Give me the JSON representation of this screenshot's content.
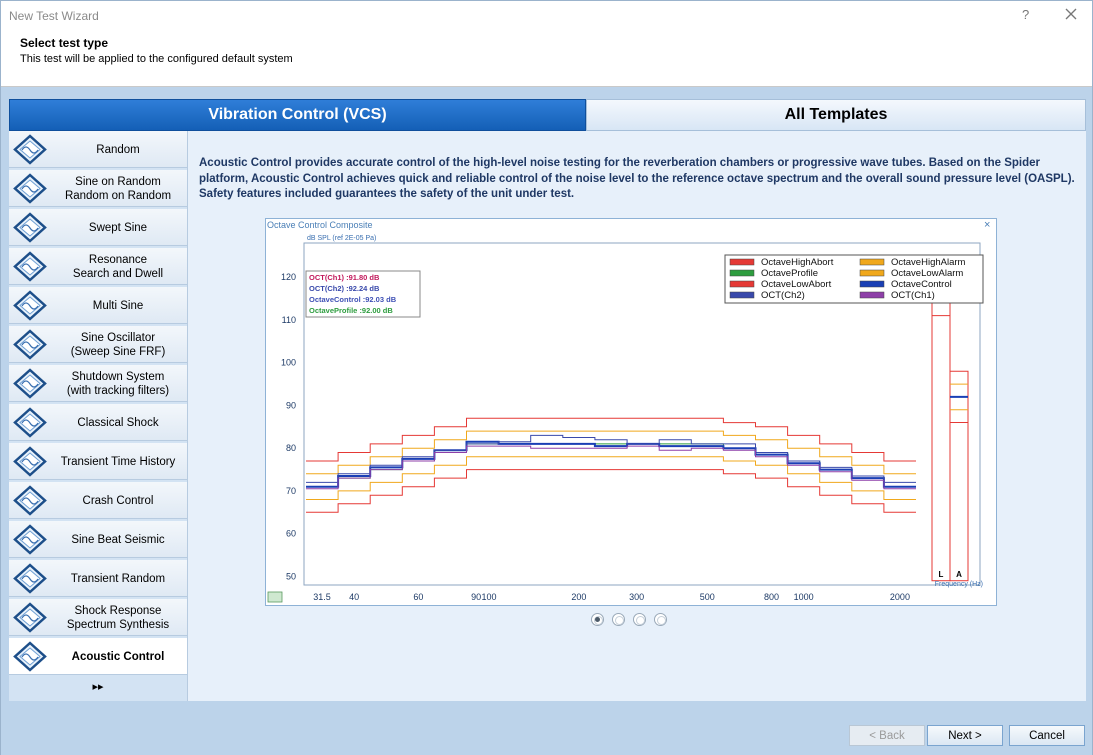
{
  "window": {
    "title": "New Test Wizard",
    "help_glyph": "?"
  },
  "header": {
    "title": "Select test type",
    "subtitle": "This test will be applied to the configured default system"
  },
  "tabs": [
    {
      "label": "Vibration Control (VCS)",
      "active": true
    },
    {
      "label": "All Templates",
      "active": false
    }
  ],
  "sidebar": {
    "items": [
      {
        "label": "Random"
      },
      {
        "label": "Sine on Random\nRandom on Random"
      },
      {
        "label": "Swept Sine"
      },
      {
        "label": "Resonance\nSearch and Dwell"
      },
      {
        "label": "Multi Sine"
      },
      {
        "label": "Sine Oscillator\n(Sweep Sine FRF)"
      },
      {
        "label": "Shutdown System\n(with tracking filters)"
      },
      {
        "label": "Classical Shock"
      },
      {
        "label": "Transient Time History"
      },
      {
        "label": "Crash Control"
      },
      {
        "label": "Sine Beat Seismic"
      },
      {
        "label": "Transient Random"
      },
      {
        "label": "Shock Response\nSpectrum Synthesis"
      },
      {
        "label": "Acoustic Control",
        "active": true
      }
    ],
    "more_glyph": "▸▸"
  },
  "description": "Acoustic Control provides accurate control of the high-level noise testing for the reverberation chambers or progressive wave tubes. Based on the Spider platform, Acoustic Control achieves quick and reliable control of the noise level to the reference octave spectrum and the overall sound pressure level (OASPL). Safety features included guarantees the safety of the unit under test.",
  "chart_panel": {
    "title": "Octave Control Composite",
    "close_glyph": "×"
  },
  "chart_data": {
    "type": "line",
    "ylabel": "dB SPL (ref 2E-05 Pa)",
    "xlabel": "Frequency (Hz)",
    "y_ticks": [
      50,
      60,
      70,
      80,
      90,
      100,
      110,
      120
    ],
    "ylim": [
      48,
      128
    ],
    "x_tick_labels": [
      "31.5",
      "40",
      "60",
      "90",
      "100",
      "200",
      "300",
      "500",
      "800",
      "1000",
      "2000"
    ],
    "extra_labels": [
      "L",
      "A"
    ],
    "readouts": [
      {
        "text": "OCT(Ch1) :91.80 dB",
        "color": "#c2185b"
      },
      {
        "text": "OCT(Ch2) :92.24 dB",
        "color": "#3949ab"
      },
      {
        "text": "OctaveControl :92.03 dB",
        "color": "#3f51b5"
      },
      {
        "text": "OctaveProfile :92.00 dB",
        "color": "#2e9d3f"
      }
    ],
    "legend": [
      {
        "name": "OctaveHighAbort",
        "color": "#e53935"
      },
      {
        "name": "OctaveHighAlarm",
        "color": "#f0a81c"
      },
      {
        "name": "OctaveProfile",
        "color": "#2e9d3f"
      },
      {
        "name": "OctaveLowAlarm",
        "color": "#f0a81c"
      },
      {
        "name": "OctaveLowAbort",
        "color": "#e53935"
      },
      {
        "name": "OctaveControl",
        "color": "#1a3fb5"
      },
      {
        "name": "OCT(Ch2)",
        "color": "#3949ab"
      },
      {
        "name": "OCT(Ch1)",
        "color": "#8e3fa8"
      }
    ],
    "bands": [
      "31.5",
      "40",
      "50",
      "63",
      "80",
      "100",
      "125",
      "160",
      "200",
      "250",
      "315",
      "400",
      "500",
      "630",
      "800",
      "1000",
      "1250",
      "1600",
      "2000"
    ],
    "series": [
      {
        "name": "OctaveHighAbort",
        "color": "#e53935",
        "values": [
          77,
          79,
          81,
          83,
          85,
          87,
          87,
          87,
          87,
          87,
          87,
          87,
          87,
          86,
          85,
          83,
          81,
          79,
          77
        ]
      },
      {
        "name": "OctaveHighAlarm",
        "color": "#f0a81c",
        "values": [
          74,
          76,
          78,
          80,
          82,
          84,
          84,
          84,
          84,
          84,
          84,
          84,
          84,
          83,
          82,
          80,
          78,
          76,
          74
        ]
      },
      {
        "name": "OctaveProfile",
        "color": "#2e9d3f",
        "values": [
          71,
          73,
          75,
          77,
          79,
          81,
          81,
          81,
          81,
          81,
          81,
          81,
          81,
          80,
          79,
          77,
          75,
          73,
          71
        ]
      },
      {
        "name": "OctaveLowAlarm",
        "color": "#f0a81c",
        "values": [
          68,
          70,
          72,
          74,
          76,
          78,
          78,
          78,
          78,
          78,
          78,
          78,
          78,
          77,
          76,
          74,
          72,
          70,
          68
        ]
      },
      {
        "name": "OctaveLowAbort",
        "color": "#e53935",
        "values": [
          65,
          67,
          69,
          71,
          73,
          75,
          75,
          75,
          75,
          75,
          75,
          75,
          75,
          74,
          73,
          71,
          69,
          67,
          65
        ]
      },
      {
        "name": "OctaveControl",
        "color": "#1a3fb5",
        "values": [
          71,
          73.5,
          75.5,
          77.5,
          79.5,
          81.5,
          81,
          81,
          81,
          80.5,
          81,
          80.5,
          80.5,
          80,
          78.5,
          76.5,
          75,
          73,
          71
        ]
      },
      {
        "name": "OCT(Ch2)",
        "color": "#3949ab",
        "values": [
          72,
          74,
          76,
          78,
          79.5,
          81,
          81.5,
          83,
          82.5,
          82,
          81,
          82,
          81,
          81,
          79,
          77,
          75.5,
          73.5,
          72
        ]
      },
      {
        "name": "OCT(Ch1)",
        "color": "#8e3fa8",
        "values": [
          70.5,
          73,
          75,
          77,
          79,
          80.5,
          80.5,
          80,
          80,
          80,
          80.5,
          79.5,
          80,
          79.5,
          78,
          76,
          74.5,
          72.5,
          70.5
        ]
      }
    ],
    "overall": {
      "L": {
        "high_abort": 123,
        "high_alarm": 120,
        "profile": 117,
        "control": 115,
        "low_alarm": 114,
        "low_abort": 111
      },
      "A": {
        "high_abort": 98,
        "high_alarm": 95,
        "profile": 92,
        "control": 92,
        "low_alarm": 89,
        "low_abort": 86
      }
    }
  },
  "pager": {
    "count": 4,
    "active_index": 0
  },
  "footer": {
    "back_label": "< Back",
    "next_label": "Next >",
    "cancel_label": "Cancel"
  }
}
